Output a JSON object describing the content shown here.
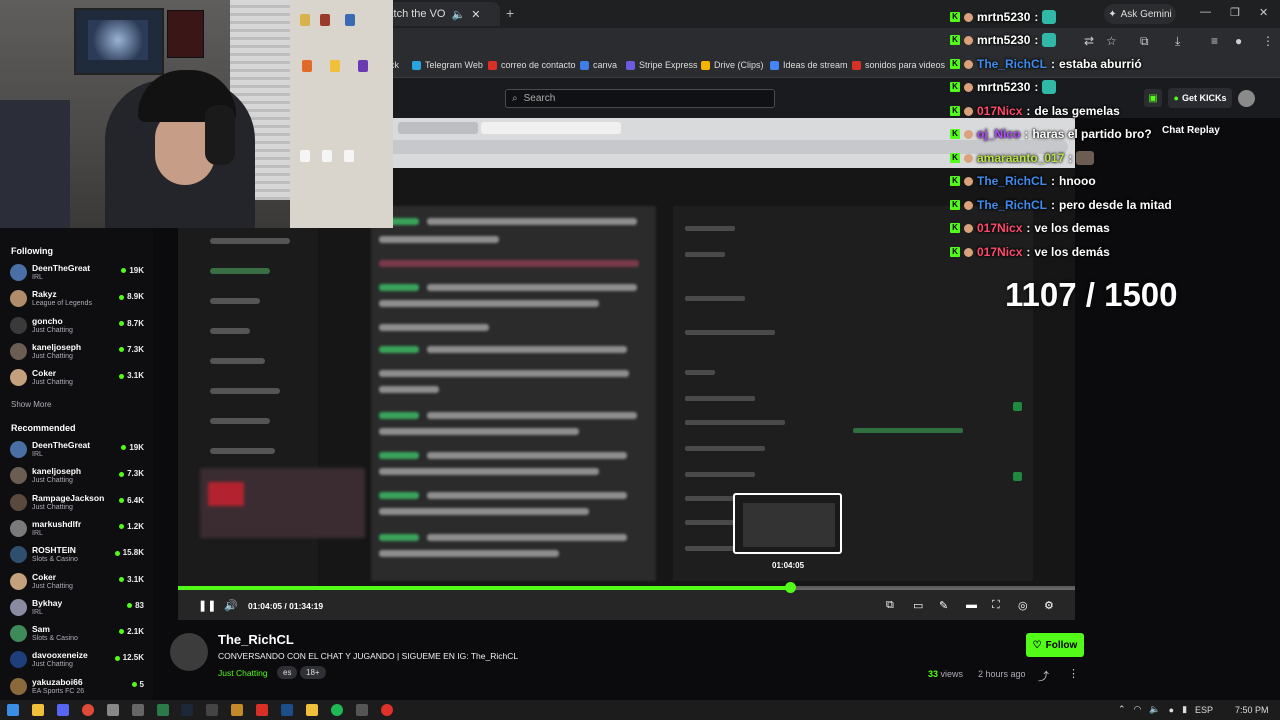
{
  "browser": {
    "tab_title": "CL - Watch the VO",
    "new_tab": "+",
    "ask_gemini": "Ask Gemini",
    "bookmarks": [
      {
        "label": "ck",
        "color": "#888888"
      },
      {
        "label": "Telegram Web",
        "color": "#2aa3e0"
      },
      {
        "label": "correo de contacto",
        "color": "#d93025"
      },
      {
        "label": "canva",
        "color": "#3f7de8"
      },
      {
        "label": "Stripe Express",
        "color": "#6a5be0"
      },
      {
        "label": "Drive (Clips)",
        "color": "#f4b400"
      },
      {
        "label": "Ideas de stream",
        "color": "#4285f4"
      },
      {
        "label": "sonidos para videos",
        "color": "#d93025"
      }
    ]
  },
  "header": {
    "search_placeholder": "Search",
    "get_kicks": "Get KICKs",
    "chat_replay": "Chat Replay"
  },
  "sidebar": {
    "following_heading": "Following",
    "following": [
      {
        "name": "DeenTheGreat",
        "category": "IRL",
        "viewers": "19K",
        "color": "#4a6fa5"
      },
      {
        "name": "Rakyz",
        "category": "League of Legends",
        "viewers": "8.9K",
        "color": "#b08c6a"
      },
      {
        "name": "goncho",
        "category": "Just Chatting",
        "viewers": "8.7K",
        "color": "#3a3a3a"
      },
      {
        "name": "kaneljoseph",
        "category": "Just Chatting",
        "viewers": "7.3K",
        "color": "#6b5d52"
      },
      {
        "name": "Coker",
        "category": "Just Chatting",
        "viewers": "3.1K",
        "color": "#c4a07c"
      }
    ],
    "show_more": "Show More",
    "recommended_heading": "Recommended",
    "recommended": [
      {
        "name": "DeenTheGreat",
        "category": "IRL",
        "viewers": "19K",
        "color": "#4a6fa5"
      },
      {
        "name": "kaneljoseph",
        "category": "Just Chatting",
        "viewers": "7.3K",
        "color": "#6b5d52"
      },
      {
        "name": "RampageJackson",
        "category": "Just Chatting",
        "viewers": "6.4K",
        "color": "#5a4a3e"
      },
      {
        "name": "markushdlfr",
        "category": "IRL",
        "viewers": "1.2K",
        "color": "#7a7a7a"
      },
      {
        "name": "ROSHTEIN",
        "category": "Slots & Casino",
        "viewers": "15.8K",
        "color": "#2f4f6f"
      },
      {
        "name": "Coker",
        "category": "Just Chatting",
        "viewers": "3.1K",
        "color": "#c4a07c"
      },
      {
        "name": "Bykhay",
        "category": "IRL",
        "viewers": "83",
        "color": "#8a8aa0"
      },
      {
        "name": "Sam",
        "category": "Slots & Casino",
        "viewers": "2.1K",
        "color": "#3f8a5a"
      },
      {
        "name": "davooxeneize",
        "category": "Just Chatting",
        "viewers": "12.5K",
        "color": "#1f3f7a"
      },
      {
        "name": "yakuzaboi66",
        "category": "EA Sports FC 26",
        "viewers": "5",
        "color": "#8a6a3a"
      }
    ]
  },
  "player": {
    "progress_fraction": 0.682,
    "time_readout": "01:04:05 / 01:34:19",
    "thumbnail_time": "01:04:05"
  },
  "chat": {
    "messages": [
      {
        "user": "mrtn5230",
        "text": "",
        "emote": true,
        "color": "#ffffff"
      },
      {
        "user": "mrtn5230",
        "text": "",
        "emote": true,
        "color": "#ffffff"
      },
      {
        "user": "The_RichCL",
        "text": "estaba aburrió",
        "emote": false,
        "color": "#3d8cf0"
      },
      {
        "user": "mrtn5230",
        "text": "",
        "emote": true,
        "color": "#ffffff"
      },
      {
        "user": "017Nicx",
        "text": "de las gemelas",
        "emote": false,
        "color": "#ff4a6e"
      },
      {
        "user": "oj_Nico",
        "text": "haras el partido bro?",
        "emote": false,
        "color": "#b04cff"
      },
      {
        "user": "amaraanto_017",
        "text": "",
        "emote": true,
        "color": "#b7e34a"
      },
      {
        "user": "The_RichCL",
        "text": "hnooo",
        "emote": false,
        "color": "#3d8cf0"
      },
      {
        "user": "The_RichCL",
        "text": "pero desde la mitad",
        "emote": false,
        "color": "#3d8cf0"
      },
      {
        "user": "017Nicx",
        "text": "ve los demas",
        "emote": false,
        "color": "#ff4a6e"
      },
      {
        "user": "017Nicx",
        "text": "ve los demás",
        "emote": false,
        "color": "#ff4a6e"
      }
    ],
    "goal": "1107 / 1500"
  },
  "stream": {
    "channel": "The_RichCL",
    "title": "CONVERSANDO CON EL CHAT Y JUGANDO | SIGUEME EN IG: The_RichCL",
    "category": "Just Chatting",
    "tags": [
      "es",
      "18+"
    ],
    "follow": "Follow",
    "views_count": "33",
    "views_label": "views",
    "ago": "2 hours ago"
  },
  "taskbar": {
    "lang": "ESP",
    "time": "7:50 PM"
  },
  "colors": {
    "accent": "#53fc18",
    "background": "#0b0b0d"
  }
}
